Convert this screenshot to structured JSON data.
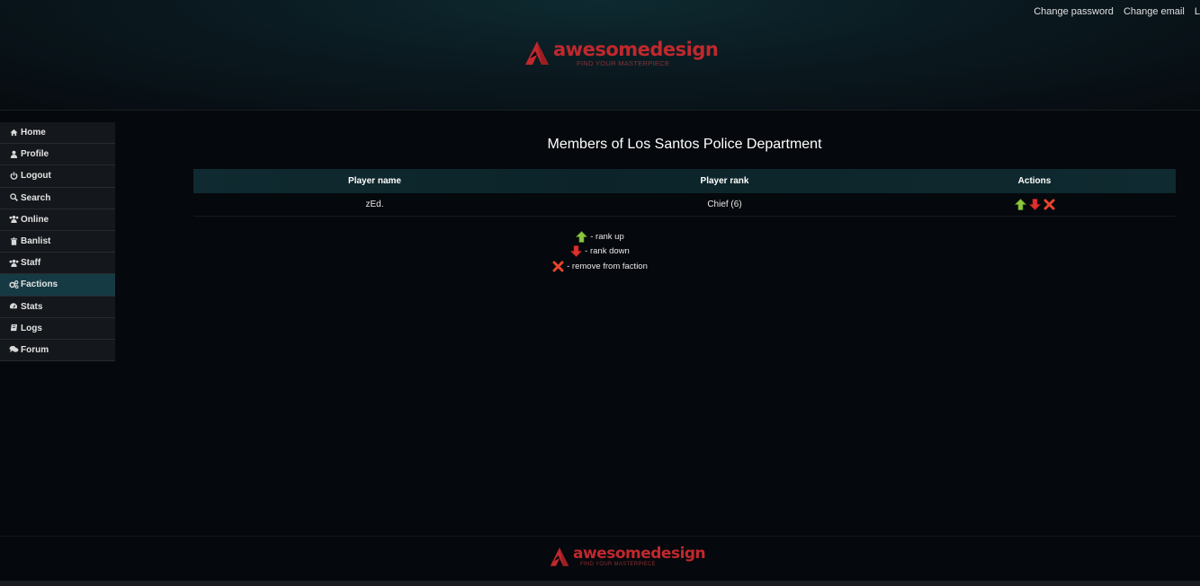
{
  "top_nav": {
    "change_password": "Change password",
    "change_email": "Change email",
    "logout_partial": "L"
  },
  "logo": {
    "name": "awesomedesign",
    "tagline": "FIND YOUR MASTERPIECE"
  },
  "sidebar": {
    "items": [
      {
        "label": "Home",
        "icon": "home-icon"
      },
      {
        "label": "Profile",
        "icon": "user-icon"
      },
      {
        "label": "Logout",
        "icon": "power-icon"
      },
      {
        "label": "Search",
        "icon": "search-icon"
      },
      {
        "label": "Online",
        "icon": "users-icon"
      },
      {
        "label": "Banlist",
        "icon": "trash-icon"
      },
      {
        "label": "Staff",
        "icon": "users-icon"
      },
      {
        "label": "Factions",
        "icon": "cogs-icon"
      },
      {
        "label": "Stats",
        "icon": "dashboard-icon"
      },
      {
        "label": "Logs",
        "icon": "book-icon"
      },
      {
        "label": "Forum",
        "icon": "comments-icon"
      }
    ],
    "active": "Factions"
  },
  "main": {
    "title": "Members of Los Santos Police Department",
    "table": {
      "headers": [
        "Player name",
        "Player rank",
        "Actions"
      ],
      "rows": [
        {
          "player_name": "zEd.",
          "player_rank": "Chief (6)"
        }
      ]
    },
    "legend": {
      "rank_up": "- rank up",
      "rank_down": "- rank down",
      "remove": "- remove from faction"
    }
  },
  "colors": {
    "accent_active": "#163a44",
    "brand_red": "#c0282d",
    "arrow_up": "#8cc63f",
    "arrow_down": "#e0302c",
    "remove": "#e8452a"
  }
}
